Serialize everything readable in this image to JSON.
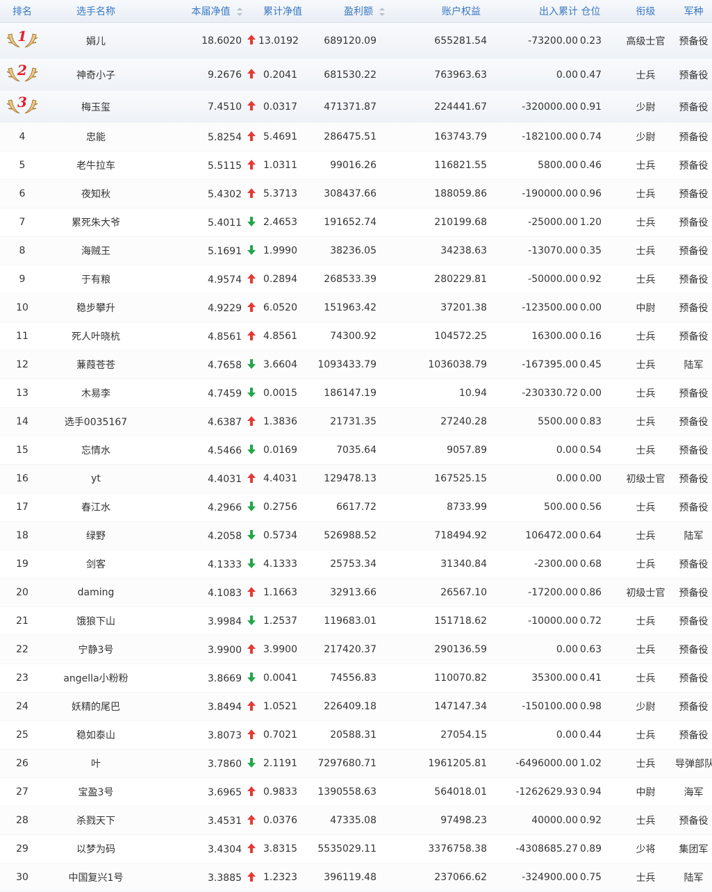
{
  "header": {
    "rank": "排名",
    "name": "选手名称",
    "current_nav": "本届净值",
    "cumulative_nav": "累计净值",
    "profit": "盈利额",
    "equity": "账户权益",
    "cash_flow": "出入累计",
    "position": "仓位",
    "grade": "衔级",
    "branch": "军种"
  },
  "colors": {
    "header_text": "#3a78c3",
    "up_arrow": "#e53935",
    "down_arrow": "#22a64a",
    "medal_number": "#e0212c"
  },
  "rows": [
    {
      "rank": "1",
      "name": "娟儿",
      "current_nav": "18.6020",
      "trend": "up",
      "cumulative_nav": "13.0192",
      "profit": "689120.09",
      "equity": "655281.54",
      "cash_flow": "-73200.00",
      "position": "0.23",
      "grade": "高级士官",
      "branch": "预备役"
    },
    {
      "rank": "2",
      "name": "神奇小子",
      "current_nav": "9.2676",
      "trend": "up",
      "cumulative_nav": "0.2041",
      "profit": "681530.22",
      "equity": "763963.63",
      "cash_flow": "0.00",
      "position": "0.47",
      "grade": "士兵",
      "branch": "预备役"
    },
    {
      "rank": "3",
      "name": "梅玉玺",
      "current_nav": "7.4510",
      "trend": "up",
      "cumulative_nav": "0.0317",
      "profit": "471371.87",
      "equity": "224441.67",
      "cash_flow": "-320000.00",
      "position": "0.91",
      "grade": "少尉",
      "branch": "预备役"
    },
    {
      "rank": "4",
      "name": "忠能",
      "current_nav": "5.8254",
      "trend": "up",
      "cumulative_nav": "5.4691",
      "profit": "286475.51",
      "equity": "163743.79",
      "cash_flow": "-182100.00",
      "position": "0.74",
      "grade": "少尉",
      "branch": "预备役"
    },
    {
      "rank": "5",
      "name": "老牛拉车",
      "current_nav": "5.5115",
      "trend": "up",
      "cumulative_nav": "1.0311",
      "profit": "99016.26",
      "equity": "116821.55",
      "cash_flow": "5800.00",
      "position": "0.46",
      "grade": "士兵",
      "branch": "预备役"
    },
    {
      "rank": "6",
      "name": "夜知秋",
      "current_nav": "5.4302",
      "trend": "up",
      "cumulative_nav": "5.3713",
      "profit": "308437.66",
      "equity": "188059.86",
      "cash_flow": "-190000.00",
      "position": "0.96",
      "grade": "士兵",
      "branch": "预备役"
    },
    {
      "rank": "7",
      "name": "累死朱大爷",
      "current_nav": "5.4011",
      "trend": "down",
      "cumulative_nav": "2.4653",
      "profit": "191652.74",
      "equity": "210199.68",
      "cash_flow": "-25000.00",
      "position": "1.20",
      "grade": "士兵",
      "branch": "预备役"
    },
    {
      "rank": "8",
      "name": "海贼王",
      "current_nav": "5.1691",
      "trend": "down",
      "cumulative_nav": "1.9990",
      "profit": "38236.05",
      "equity": "34238.63",
      "cash_flow": "-13070.00",
      "position": "0.35",
      "grade": "士兵",
      "branch": "预备役"
    },
    {
      "rank": "9",
      "name": "于有粮",
      "current_nav": "4.9574",
      "trend": "up",
      "cumulative_nav": "0.2894",
      "profit": "268533.39",
      "equity": "280229.81",
      "cash_flow": "-50000.00",
      "position": "0.92",
      "grade": "士兵",
      "branch": "预备役"
    },
    {
      "rank": "10",
      "name": "稳步攀升",
      "current_nav": "4.9229",
      "trend": "up",
      "cumulative_nav": "6.0520",
      "profit": "151963.42",
      "equity": "37201.38",
      "cash_flow": "-123500.00",
      "position": "0.00",
      "grade": "中尉",
      "branch": "预备役"
    },
    {
      "rank": "11",
      "name": "死人叶晓杭",
      "current_nav": "4.8561",
      "trend": "up",
      "cumulative_nav": "4.8561",
      "profit": "74300.92",
      "equity": "104572.25",
      "cash_flow": "16300.00",
      "position": "0.16",
      "grade": "士兵",
      "branch": "预备役"
    },
    {
      "rank": "12",
      "name": "蒹葭苍苍",
      "current_nav": "4.7658",
      "trend": "down",
      "cumulative_nav": "3.6604",
      "profit": "1093433.79",
      "equity": "1036038.79",
      "cash_flow": "-167395.00",
      "position": "0.45",
      "grade": "士兵",
      "branch": "陆军"
    },
    {
      "rank": "13",
      "name": "木易李",
      "current_nav": "4.7459",
      "trend": "down",
      "cumulative_nav": "0.0015",
      "profit": "186147.19",
      "equity": "10.94",
      "cash_flow": "-230330.72",
      "position": "0.00",
      "grade": "士兵",
      "branch": "预备役"
    },
    {
      "rank": "14",
      "name": "选手0035167",
      "current_nav": "4.6387",
      "trend": "up",
      "cumulative_nav": "1.3836",
      "profit": "21731.35",
      "equity": "27240.28",
      "cash_flow": "5500.00",
      "position": "0.83",
      "grade": "士兵",
      "branch": "预备役"
    },
    {
      "rank": "15",
      "name": "忘情水",
      "current_nav": "4.5466",
      "trend": "down",
      "cumulative_nav": "0.0169",
      "profit": "7035.64",
      "equity": "9057.89",
      "cash_flow": "0.00",
      "position": "0.54",
      "grade": "士兵",
      "branch": "预备役"
    },
    {
      "rank": "16",
      "name": "yt",
      "current_nav": "4.4031",
      "trend": "up",
      "cumulative_nav": "4.4031",
      "profit": "129478.13",
      "equity": "167525.15",
      "cash_flow": "0.00",
      "position": "0.00",
      "grade": "初级士官",
      "branch": "预备役"
    },
    {
      "rank": "17",
      "name": "春江水",
      "current_nav": "4.2966",
      "trend": "down",
      "cumulative_nav": "0.2756",
      "profit": "6617.72",
      "equity": "8733.99",
      "cash_flow": "500.00",
      "position": "0.56",
      "grade": "士兵",
      "branch": "预备役"
    },
    {
      "rank": "18",
      "name": "绿野",
      "current_nav": "4.2058",
      "trend": "down",
      "cumulative_nav": "0.5734",
      "profit": "526988.52",
      "equity": "718494.92",
      "cash_flow": "106472.00",
      "position": "0.64",
      "grade": "士兵",
      "branch": "陆军"
    },
    {
      "rank": "19",
      "name": "剑客",
      "current_nav": "4.1333",
      "trend": "down",
      "cumulative_nav": "4.1333",
      "profit": "25753.34",
      "equity": "31340.84",
      "cash_flow": "-2300.00",
      "position": "0.68",
      "grade": "士兵",
      "branch": "预备役"
    },
    {
      "rank": "20",
      "name": "daming",
      "current_nav": "4.1083",
      "trend": "up",
      "cumulative_nav": "1.1663",
      "profit": "32913.66",
      "equity": "26567.10",
      "cash_flow": "-17200.00",
      "position": "0.86",
      "grade": "初级士官",
      "branch": "预备役"
    },
    {
      "rank": "21",
      "name": "饿狼下山",
      "current_nav": "3.9984",
      "trend": "down",
      "cumulative_nav": "1.2537",
      "profit": "119683.01",
      "equity": "151718.62",
      "cash_flow": "-10000.00",
      "position": "0.72",
      "grade": "士兵",
      "branch": "预备役"
    },
    {
      "rank": "22",
      "name": "宁静3号",
      "current_nav": "3.9900",
      "trend": "up",
      "cumulative_nav": "3.9900",
      "profit": "217420.37",
      "equity": "290136.59",
      "cash_flow": "0.00",
      "position": "0.63",
      "grade": "士兵",
      "branch": "预备役"
    },
    {
      "rank": "23",
      "name": "angella小粉粉",
      "current_nav": "3.8669",
      "trend": "down",
      "cumulative_nav": "0.0041",
      "profit": "74556.83",
      "equity": "110070.82",
      "cash_flow": "35300.00",
      "position": "0.41",
      "grade": "士兵",
      "branch": "预备役"
    },
    {
      "rank": "24",
      "name": "妖精的尾巴",
      "current_nav": "3.8494",
      "trend": "up",
      "cumulative_nav": "1.0521",
      "profit": "226409.18",
      "equity": "147147.34",
      "cash_flow": "-150100.00",
      "position": "0.98",
      "grade": "少尉",
      "branch": "预备役"
    },
    {
      "rank": "25",
      "name": "稳如泰山",
      "current_nav": "3.8073",
      "trend": "up",
      "cumulative_nav": "0.7021",
      "profit": "20588.31",
      "equity": "27054.15",
      "cash_flow": "0.00",
      "position": "0.44",
      "grade": "士兵",
      "branch": "预备役"
    },
    {
      "rank": "26",
      "name": "叶",
      "current_nav": "3.7860",
      "trend": "down",
      "cumulative_nav": "2.1191",
      "profit": "7297680.71",
      "equity": "1961205.81",
      "cash_flow": "-6496000.00",
      "position": "1.02",
      "grade": "士兵",
      "branch": "导弹部队"
    },
    {
      "rank": "27",
      "name": "宝盈3号",
      "current_nav": "3.6965",
      "trend": "up",
      "cumulative_nav": "0.9833",
      "profit": "1390558.63",
      "equity": "564018.01",
      "cash_flow": "-1262629.93",
      "position": "0.94",
      "grade": "中尉",
      "branch": "海军"
    },
    {
      "rank": "28",
      "name": "杀戮天下",
      "current_nav": "3.4531",
      "trend": "up",
      "cumulative_nav": "0.0376",
      "profit": "47335.08",
      "equity": "97498.23",
      "cash_flow": "40000.00",
      "position": "0.92",
      "grade": "士兵",
      "branch": "预备役"
    },
    {
      "rank": "29",
      "name": "以梦为码",
      "current_nav": "3.4304",
      "trend": "up",
      "cumulative_nav": "3.8315",
      "profit": "5535029.11",
      "equity": "3376758.38",
      "cash_flow": "-4308685.27",
      "position": "0.89",
      "grade": "少将",
      "branch": "集团军"
    },
    {
      "rank": "30",
      "name": "中国复兴1号",
      "current_nav": "3.3885",
      "trend": "up",
      "cumulative_nav": "1.2323",
      "profit": "396119.48",
      "equity": "237066.62",
      "cash_flow": "-324900.00",
      "position": "0.75",
      "grade": "士兵",
      "branch": "陆军"
    }
  ]
}
